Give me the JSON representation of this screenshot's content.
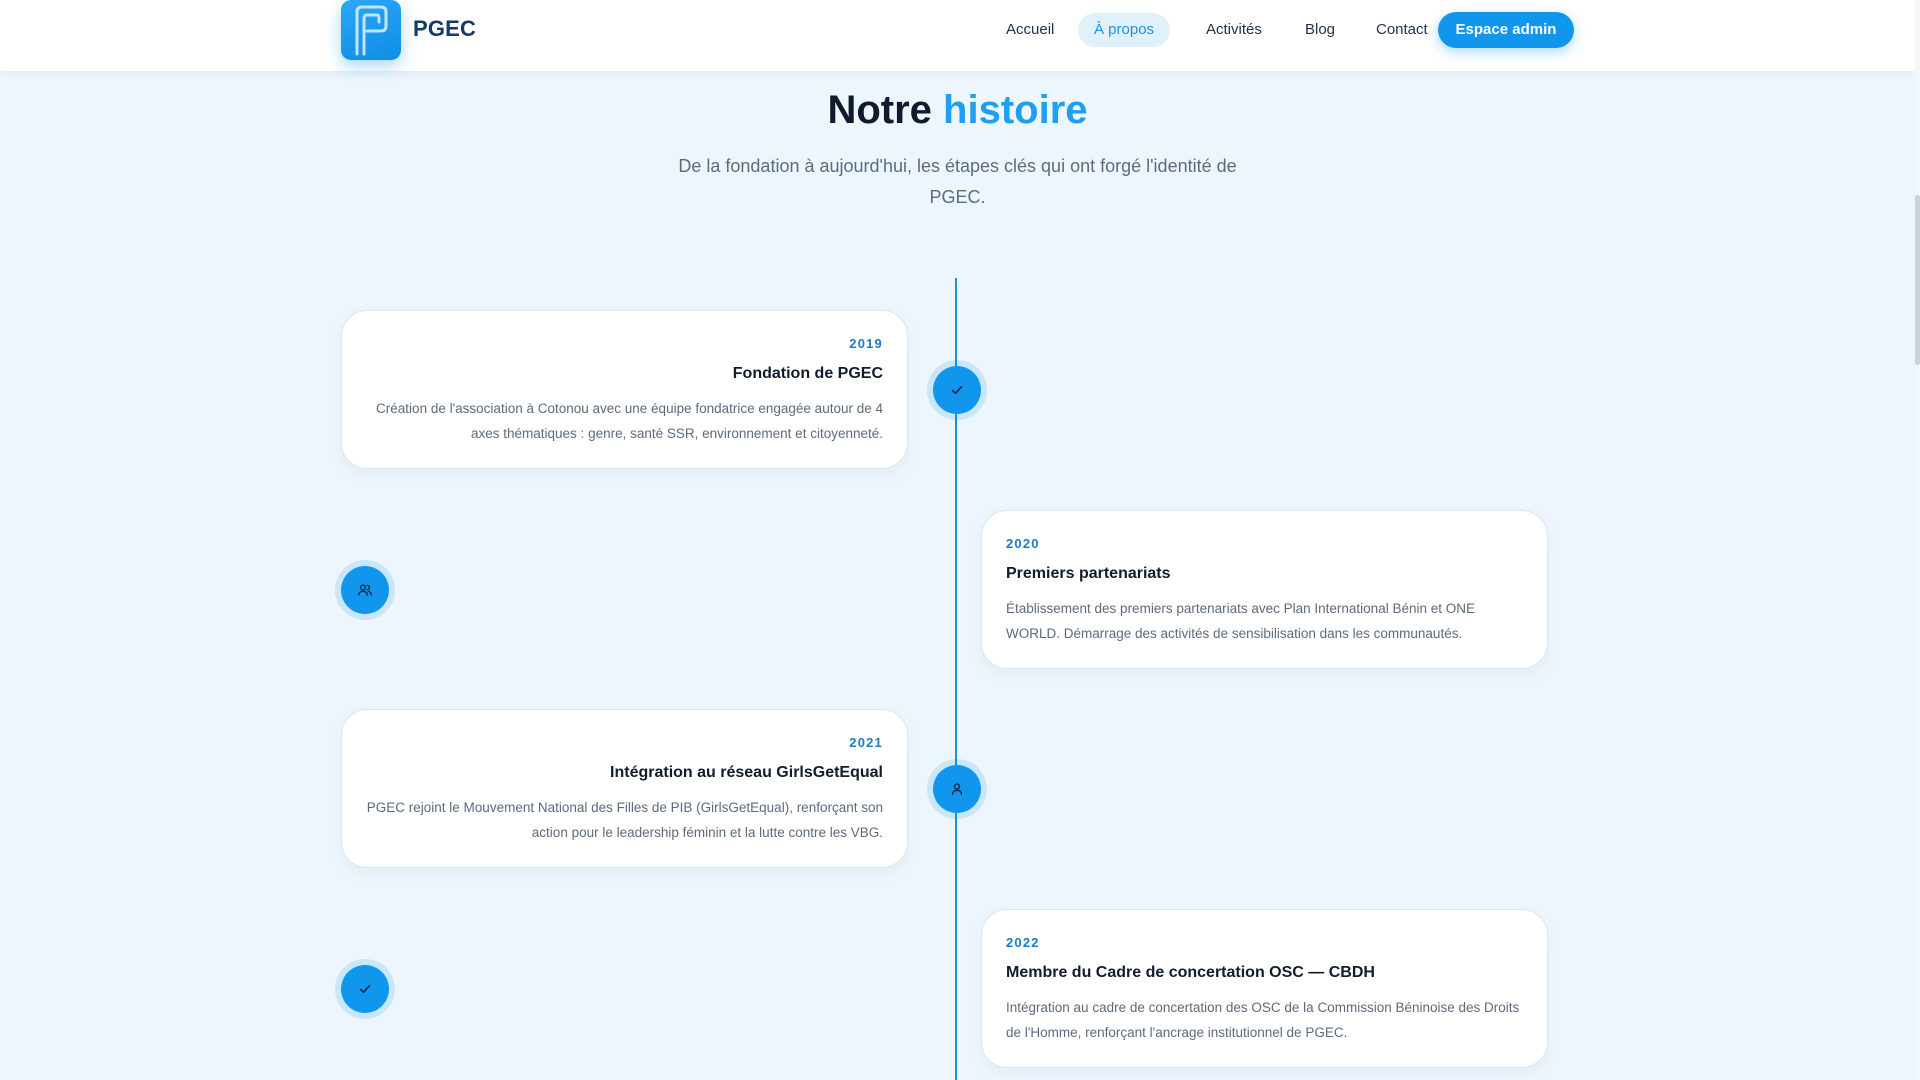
{
  "header": {
    "brand": "PGEC",
    "nav": [
      {
        "label": "Accueil",
        "active": false
      },
      {
        "label": "À propos",
        "active": true
      },
      {
        "label": "Activités",
        "active": false
      },
      {
        "label": "Blog",
        "active": false
      },
      {
        "label": "Contact",
        "active": false
      }
    ],
    "admin_label": "Espace admin"
  },
  "section": {
    "title_main": "Notre",
    "title_accent": "histoire",
    "subtitle": "De la fondation à aujourd'hui, les étapes clés qui ont forgé l'identité de PGEC."
  },
  "timeline": [
    {
      "year": "2019",
      "title": "Fondation de PGEC",
      "description": "Création de l'association à Cotonou avec une équipe fondatrice engagée autour de 4 axes thématiques : genre, santé SSR, environnement et citoyenneté.",
      "icon": "check-icon"
    },
    {
      "year": "2020",
      "title": "Premiers partenariats",
      "description": "Établissement des premiers partenariats avec Plan International Bénin et ONE WORLD. Démarrage des activités de sensibilisation dans les communautés.",
      "icon": "users-icon"
    },
    {
      "year": "2021",
      "title": "Intégration au réseau GirlsGetEqual",
      "description": "PGEC rejoint le Mouvement National des Filles de PIB (GirlsGetEqual), renforçant son action pour le leadership féminin et la lutte contre les VBG.",
      "icon": "user-icon"
    },
    {
      "year": "2022",
      "title": "Membre du Cadre de concertation OSC — CBDH",
      "description": "Intégration au cadre de concertation des OSC de la Commission Béninoise des Droits de l'Homme, renforçant l'ancrage institutionnel de PGEC.",
      "icon": "check-icon"
    }
  ],
  "colors": {
    "accent": "#1196ee",
    "background": "#eef6fd",
    "brand_text": "#173a66"
  }
}
